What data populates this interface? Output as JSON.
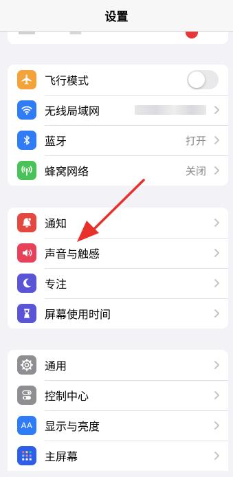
{
  "nav": {
    "title": "设置"
  },
  "colors": {
    "background": "#f2f2f7",
    "airplane": "#f4a23a",
    "wifi": "#2f7cf6",
    "bluetooth": "#2f7cf6",
    "cellular": "#4ac25a",
    "notifications": "#e5483e",
    "sounds": "#e8425a",
    "focus": "#5a54d6",
    "screentime": "#5a54d6",
    "general": "#8e8e93",
    "control_center": "#8e8e93",
    "display": "#2f7cf6",
    "home_screen": "#2f5fe8",
    "annotation_arrow": "#e8312a"
  },
  "group1": {
    "airplane": {
      "label": "飞行模式",
      "icon": "airplane-icon",
      "toggle_on": false
    },
    "wifi": {
      "label": "无线局域网",
      "icon": "wifi-icon"
    },
    "bluetooth": {
      "label": "蓝牙",
      "value": "打开",
      "icon": "bluetooth-icon"
    },
    "cellular": {
      "label": "蜂窝网络",
      "value": "关闭",
      "icon": "cellular-icon"
    }
  },
  "group2": {
    "notifications": {
      "label": "通知",
      "icon": "bell-icon"
    },
    "sounds": {
      "label": "声音与触感",
      "icon": "speaker-icon"
    },
    "focus": {
      "label": "专注",
      "icon": "moon-icon"
    },
    "screentime": {
      "label": "屏幕使用时间",
      "icon": "hourglass-icon"
    }
  },
  "group3": {
    "general": {
      "label": "通用",
      "icon": "gear-icon"
    },
    "control_center": {
      "label": "控制中心",
      "icon": "switches-icon"
    },
    "display": {
      "label": "显示与亮度",
      "icon": "text-size-icon",
      "icon_text": "AA"
    },
    "home_screen": {
      "label": "主屏幕",
      "icon": "home-grid-icon"
    }
  }
}
